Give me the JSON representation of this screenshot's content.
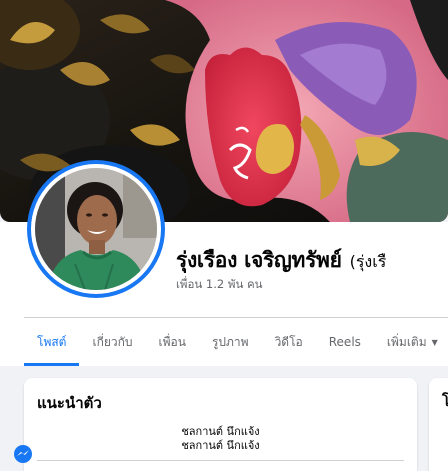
{
  "profile": {
    "name": "รุ่งเรือง เจริญทรัพย์",
    "alt_name": "(รุ่งเรื",
    "friends": "เพื่อน 1.2 พัน คน"
  },
  "tabs": [
    {
      "label": "โพสต์",
      "active": true
    },
    {
      "label": "เกี่ยวกับ",
      "active": false
    },
    {
      "label": "เพื่อน",
      "active": false
    },
    {
      "label": "รูปภาพ",
      "active": false
    },
    {
      "label": "วิดีโอ",
      "active": false
    },
    {
      "label": "Reels",
      "active": false
    },
    {
      "label": "เพิ่มเติม",
      "active": false
    }
  ],
  "intro": {
    "title": "แนะนำตัว",
    "bio_lines": [
      "ชลกานต์ นึกแจ้ง",
      "ชลกานต์ นึกแจ้ง"
    ]
  },
  "side_card": {
    "title": "โ"
  },
  "colors": {
    "accent": "#1877f2",
    "secondary_text": "#65676b",
    "background": "#f0f2f5"
  }
}
